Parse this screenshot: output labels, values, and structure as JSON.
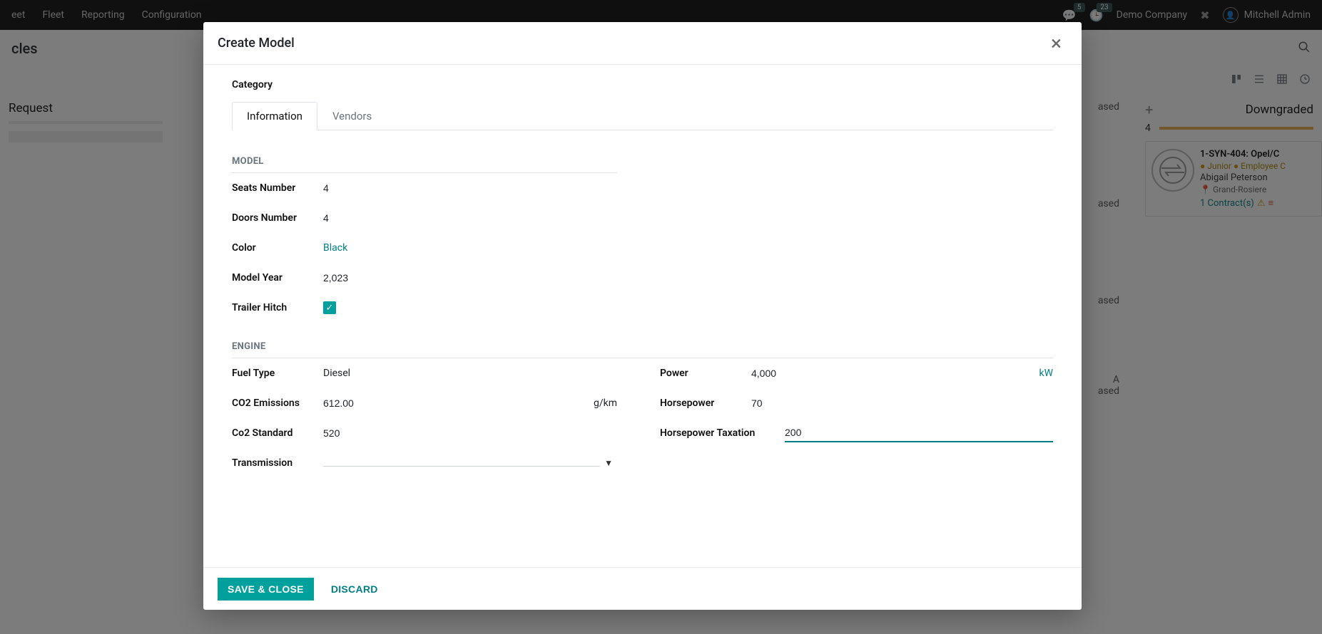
{
  "navbar": {
    "app": "eet",
    "items": [
      "Fleet",
      "Reporting",
      "Configuration"
    ],
    "msg_badge": "5",
    "clock_badge": "23",
    "company": "Demo Company",
    "user": "Mitchell Admin"
  },
  "page": {
    "title": "cles",
    "left_column": "Request",
    "right_column": "Downgraded",
    "right_count": "4",
    "kanban_item_purchased": "ased"
  },
  "vehicle_card": {
    "title": "1-SYN-404: Opel/C",
    "tag1": "Junior",
    "tag2": "Employee C",
    "driver": "Abigail Peterson",
    "location": "Grand-Rosiere",
    "contracts": "1 Contract(s)"
  },
  "modal": {
    "title": "Create Model",
    "tabs": {
      "information": "Information",
      "vendors": "Vendors"
    },
    "category_label": "Category",
    "sections": {
      "model": "MODEL",
      "engine": "ENGINE"
    },
    "fields": {
      "seats_label": "Seats Number",
      "seats_value": "4",
      "doors_label": "Doors Number",
      "doors_value": "4",
      "color_label": "Color",
      "color_value": "Black",
      "year_label": "Model Year",
      "year_value": "2,023",
      "hitch_label": "Trailer Hitch",
      "fuel_label": "Fuel Type",
      "fuel_value": "Diesel",
      "co2e_label": "CO2 Emissions",
      "co2e_value": "612.00",
      "co2e_unit": "g/km",
      "co2s_label": "Co2 Standard",
      "co2s_value": "520",
      "trans_label": "Transmission",
      "trans_value": "",
      "power_label": "Power",
      "power_value": "4,000",
      "power_unit": "kW",
      "hp_label": "Horsepower",
      "hp_value": "70",
      "hptax_label": "Horsepower Taxation",
      "hptax_value": "200"
    },
    "buttons": {
      "save": "SAVE & CLOSE",
      "discard": "DISCARD"
    }
  }
}
